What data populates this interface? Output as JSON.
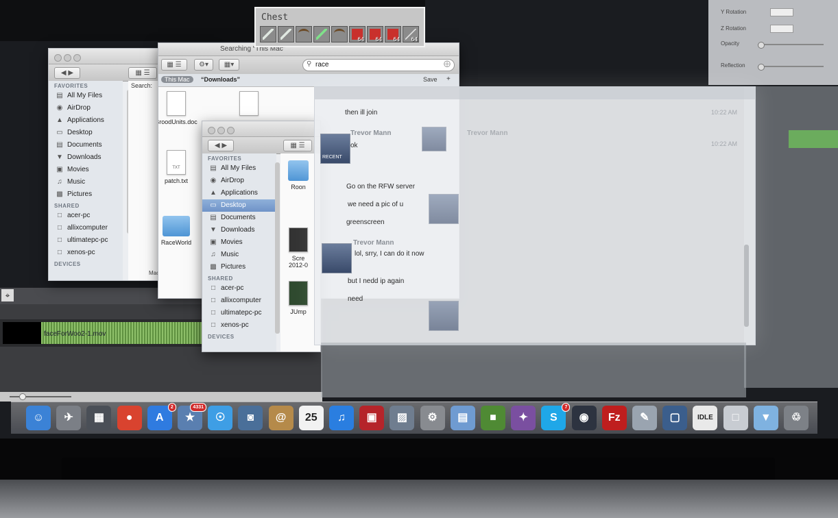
{
  "chest": {
    "title": "Chest",
    "slots": [
      {
        "icon": "sword-icon",
        "count": ""
      },
      {
        "icon": "sword-icon",
        "count": ""
      },
      {
        "icon": "bow-icon",
        "count": ""
      },
      {
        "icon": "sword-icon",
        "count": ""
      },
      {
        "icon": "bow-icon",
        "count": ""
      },
      {
        "icon": "tnt-icon",
        "count": "64"
      },
      {
        "icon": "tnt-icon",
        "count": "64"
      },
      {
        "icon": "tnt-icon",
        "count": "64"
      },
      {
        "icon": "arrow-icon",
        "count": "64"
      }
    ]
  },
  "finder_search": {
    "title": "Searching “This Mac”",
    "search_value": "race",
    "scope_this_mac": "This Mac",
    "scope_downloads": "“Downloads”",
    "save_label": "Save",
    "add_label": "+",
    "search_label": "Search:"
  },
  "finder_back": {
    "favorites_header": "FAVORITES",
    "favorites": [
      "All My Files",
      "AirDrop",
      "Applications",
      "Desktop",
      "Documents",
      "Downloads",
      "Movies",
      "Music",
      "Pictures"
    ],
    "shared_header": "SHARED",
    "shared": [
      "acer-pc",
      "allixcomputer",
      "ultimatepc-pc",
      "xenos-pc"
    ],
    "devices_header": "DEVICES",
    "files": [
      "BroodUnits.doc",
      "patch.txt",
      "RaceWorld"
    ],
    "txt_tag": "TXT",
    "path": "Macintosh HD"
  },
  "finder_front": {
    "favorites_header": "FAVORITES",
    "favorites": [
      "All My Files",
      "AirDrop",
      "Applications",
      "Desktop",
      "Documents",
      "Downloads",
      "Movies",
      "Music",
      "Pictures"
    ],
    "selected": "Desktop",
    "shared_header": "SHARED",
    "shared": [
      "acer-pc",
      "allixcomputer",
      "ultimatepc-pc",
      "xenos-pc"
    ],
    "devices_header": "DEVICES",
    "files": [
      "Roon",
      "Scre\n2012-0",
      "JUmp"
    ]
  },
  "chat": {
    "recent_label": "RECENT",
    "messages": [
      {
        "name": "",
        "text": "then ill join",
        "time": "10:22 AM"
      },
      {
        "name": "Trevor Mann",
        "text": "ok",
        "time": "10:22 AM"
      },
      {
        "name": "",
        "text": "Go on the RFW server",
        "time": ""
      },
      {
        "name": "",
        "text": "we need a pic of u",
        "time": ""
      },
      {
        "name": "",
        "text": "greenscreen",
        "time": ""
      },
      {
        "name": "Trevor Mann",
        "text": "lol, srry, I can do it now",
        "time": ""
      },
      {
        "name": "",
        "text": "but I nedd ip again",
        "time": ""
      },
      {
        "name": "",
        "text": "need",
        "time": ""
      }
    ],
    "ghost_name": "Trevor Mann"
  },
  "inspector": {
    "rows": [
      "Y Rotation",
      "Z Rotation",
      "Opacity",
      "Reflection"
    ]
  },
  "timeline": {
    "clip_label": "faceForWoo2-1.mov"
  },
  "dock": {
    "items": [
      {
        "name": "finder-icon",
        "glyph": "☺",
        "color": "#3b82d6",
        "badge": ""
      },
      {
        "name": "launchpad-icon",
        "glyph": "✈",
        "color": "#7b7f86",
        "badge": ""
      },
      {
        "name": "mission-control-icon",
        "glyph": "▦",
        "color": "#4a4f57",
        "badge": ""
      },
      {
        "name": "chrome-icon",
        "glyph": "●",
        "color": "#d9432f",
        "badge": ""
      },
      {
        "name": "app-store-icon",
        "glyph": "A",
        "color": "#2f7be0",
        "badge": "2"
      },
      {
        "name": "photo-icon",
        "glyph": "★",
        "color": "#5a7fb0",
        "badge": "4331"
      },
      {
        "name": "safari-icon",
        "glyph": "☉",
        "color": "#3e9ee5",
        "badge": ""
      },
      {
        "name": "facetime-icon",
        "glyph": "◙",
        "color": "#4a6f99",
        "badge": ""
      },
      {
        "name": "contacts-icon",
        "glyph": "@",
        "color": "#b58a4a",
        "badge": ""
      },
      {
        "name": "calendar-icon",
        "glyph": "25",
        "color": "#f2f2f2",
        "badge": ""
      },
      {
        "name": "itunes-icon",
        "glyph": "♫",
        "color": "#2a7ee0",
        "badge": ""
      },
      {
        "name": "photo-booth-icon",
        "glyph": "▣",
        "color": "#b5242a",
        "badge": ""
      },
      {
        "name": "iphoto-icon",
        "glyph": "▨",
        "color": "#6f7d8f",
        "badge": ""
      },
      {
        "name": "system-preferences-icon",
        "glyph": "⚙",
        "color": "#888b90",
        "badge": ""
      },
      {
        "name": "preview-icon",
        "glyph": "▤",
        "color": "#6f9bd1",
        "badge": ""
      },
      {
        "name": "minecraft-icon",
        "glyph": "■",
        "color": "#4f8a34",
        "badge": ""
      },
      {
        "name": "final-cut-icon",
        "glyph": "✦",
        "color": "#7a4fa0",
        "badge": ""
      },
      {
        "name": "skype-icon",
        "glyph": "S",
        "color": "#1fa7e8",
        "badge": "7"
      },
      {
        "name": "steam-icon",
        "glyph": "◉",
        "color": "#2d3340",
        "badge": ""
      },
      {
        "name": "filezilla-icon",
        "glyph": "Fz",
        "color": "#bf1e1e",
        "badge": ""
      },
      {
        "name": "script-editor-icon",
        "glyph": "✎",
        "color": "#9aa4b0",
        "badge": ""
      },
      {
        "name": "screen-capture-icon",
        "glyph": "▢",
        "color": "#3b5e8c",
        "badge": ""
      },
      {
        "name": "idle-icon",
        "glyph": "IDLE",
        "color": "#e9e9e9",
        "badge": ""
      },
      {
        "name": "documents-stack-icon",
        "glyph": "□",
        "color": "#c8ccd2",
        "badge": ""
      },
      {
        "name": "downloads-stack-icon",
        "glyph": "▼",
        "color": "#7fb2e0",
        "badge": ""
      },
      {
        "name": "trash-icon",
        "glyph": "♲",
        "color": "#7d8187",
        "badge": ""
      }
    ]
  },
  "colors": {
    "selection": "#6f93c8",
    "sidebar": "#e3e7ec",
    "waveform": "#8ec06a"
  }
}
